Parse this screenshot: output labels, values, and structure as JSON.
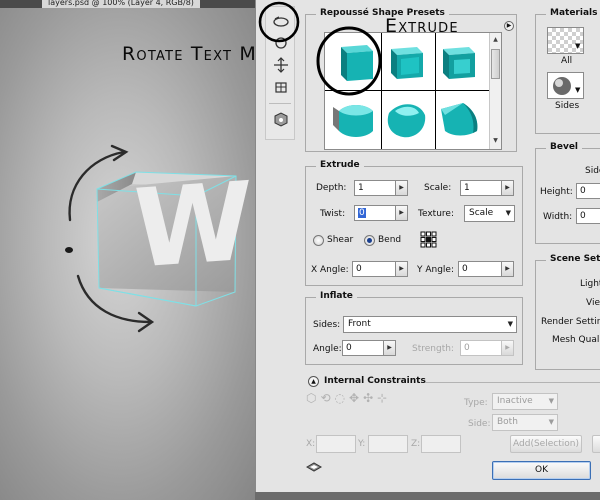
{
  "document_tab": {
    "title": "layers.psd @ 100% (Layer 4, RGB/8)",
    "close_glyph": "×"
  },
  "annotations": {
    "rotate_text_mesh": "Rotate Text Mesh",
    "extrude": "Extrude"
  },
  "canvas": {
    "letter": "W"
  },
  "repousse_presets": {
    "title": "Repoussé Shape Presets",
    "presets": [
      "extrude-cube",
      "bevel-cube",
      "inset-cube",
      "cylinder-cube",
      "inflate-cube",
      "pillow-cube"
    ]
  },
  "materials": {
    "title": "Materials",
    "all_label": "All",
    "sides_label": "Sides"
  },
  "extrude": {
    "title": "Extrude",
    "depth_label": "Depth:",
    "depth_value": "1",
    "scale_label": "Scale:",
    "scale_value": "1",
    "twist_label": "Twist:",
    "twist_value": "0",
    "texture_label": "Texture:",
    "texture_value": "Scale",
    "shear_label": "Shear",
    "bend_label": "Bend",
    "x_angle_label": "X Angle:",
    "x_angle_value": "0",
    "y_angle_label": "Y Angle:",
    "y_angle_value": "0"
  },
  "bevel": {
    "title": "Bevel",
    "sides_label": "Side",
    "height_label": "Height:",
    "height_value": "0",
    "width_label": "Width:",
    "width_value": "0"
  },
  "inflate": {
    "title": "Inflate",
    "sides_label": "Sides:",
    "sides_value": "Front",
    "angle_label": "Angle:",
    "angle_value": "0",
    "strength_label": "Strength:",
    "strength_value": "0"
  },
  "scene_settings": {
    "title": "Scene Sett",
    "lights_label": "Light",
    "view_label": "View",
    "render_label": "Render Setting",
    "mesh_label": "Mesh Qualit"
  },
  "internal_constraints": {
    "title": "Internal Constraints",
    "type_label": "Type:",
    "type_value": "Inactive",
    "side_label": "Side:",
    "side_value": "Both",
    "x_label": "X:",
    "y_label": "Y:",
    "z_label": "Z:",
    "add_selection_label": "Add(Selection)"
  },
  "footer": {
    "ok_label": "OK"
  },
  "colors": {
    "teal": "#16b3b3",
    "teal_dark": "#0a7f80",
    "dialog_bg": "#e4e4e4",
    "mesh_outline": "#7fe0e6"
  }
}
